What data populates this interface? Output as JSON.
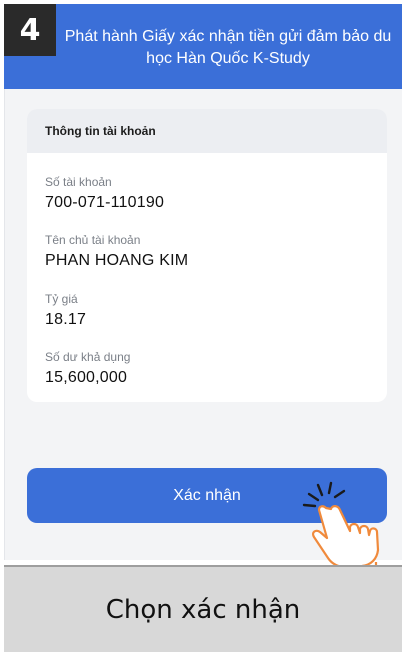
{
  "step": {
    "number": "4"
  },
  "header": {
    "title": "Phát hành Giấy xác nhận tiền gửi đảm bảo du học Hàn Quốc K-Study"
  },
  "account_card": {
    "title": "Thông tin tài khoản",
    "fields": [
      {
        "label": "Số tài khoản",
        "value": "700-071-110190"
      },
      {
        "label": "Tên chủ tài khoản",
        "value": "PHAN HOANG KIM"
      },
      {
        "label": "Tỷ giá",
        "value": "18.17"
      },
      {
        "label": "Số dư khả dụng",
        "value": "15,600,000"
      }
    ]
  },
  "confirm_button": {
    "label": "Xác nhận"
  },
  "caption": {
    "text": "Chọn xác nhận"
  },
  "colors": {
    "primary": "#3b6fd8",
    "step_box": "#2a2a2a",
    "caption_bg": "#d8d8d8",
    "hand_outline": "#f08a3c"
  },
  "icons": {
    "pointer": "tap-hand-icon"
  }
}
